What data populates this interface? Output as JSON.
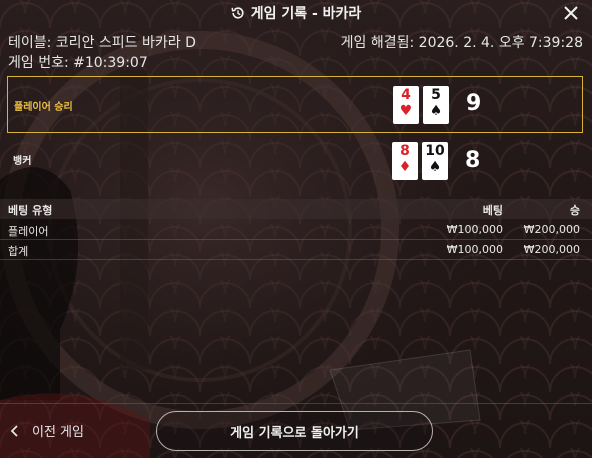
{
  "header": {
    "title": "게임 기록 - 바카라",
    "history_icon": "history-icon",
    "close_icon": "close-icon"
  },
  "info": {
    "table": "테이블: 코리안 스피드 바카라 D",
    "settled": "게임 해결됨: 2026. 2. 4. 오후 7:39:28",
    "game_number": "게임 번호: #10:39:07"
  },
  "results": {
    "player": {
      "label": "플레이어 승리",
      "cards": [
        {
          "rank": "4",
          "suit": "♥",
          "color": "red"
        },
        {
          "rank": "5",
          "suit": "♠",
          "color": "black"
        }
      ],
      "score": "9",
      "highlight_color": "#d8b23a"
    },
    "banker": {
      "label": "뱅커",
      "cards": [
        {
          "rank": "8",
          "suit": "♦",
          "color": "red"
        },
        {
          "rank": "10",
          "suit": "♠",
          "color": "black"
        }
      ],
      "score": "8"
    }
  },
  "bets": {
    "headers": {
      "type": "베팅 유형",
      "bet": "베팅",
      "win": "승"
    },
    "rows": [
      {
        "type": "플레이어",
        "bet": "₩100,000",
        "win": "₩200,000"
      },
      {
        "type": "합계",
        "bet": "₩100,000",
        "win": "₩200,000"
      }
    ]
  },
  "footer": {
    "prev_label": "이전 게임",
    "back_label": "게임 기록으로 돌아가기",
    "chevron_icon": "chevron-left-icon"
  }
}
